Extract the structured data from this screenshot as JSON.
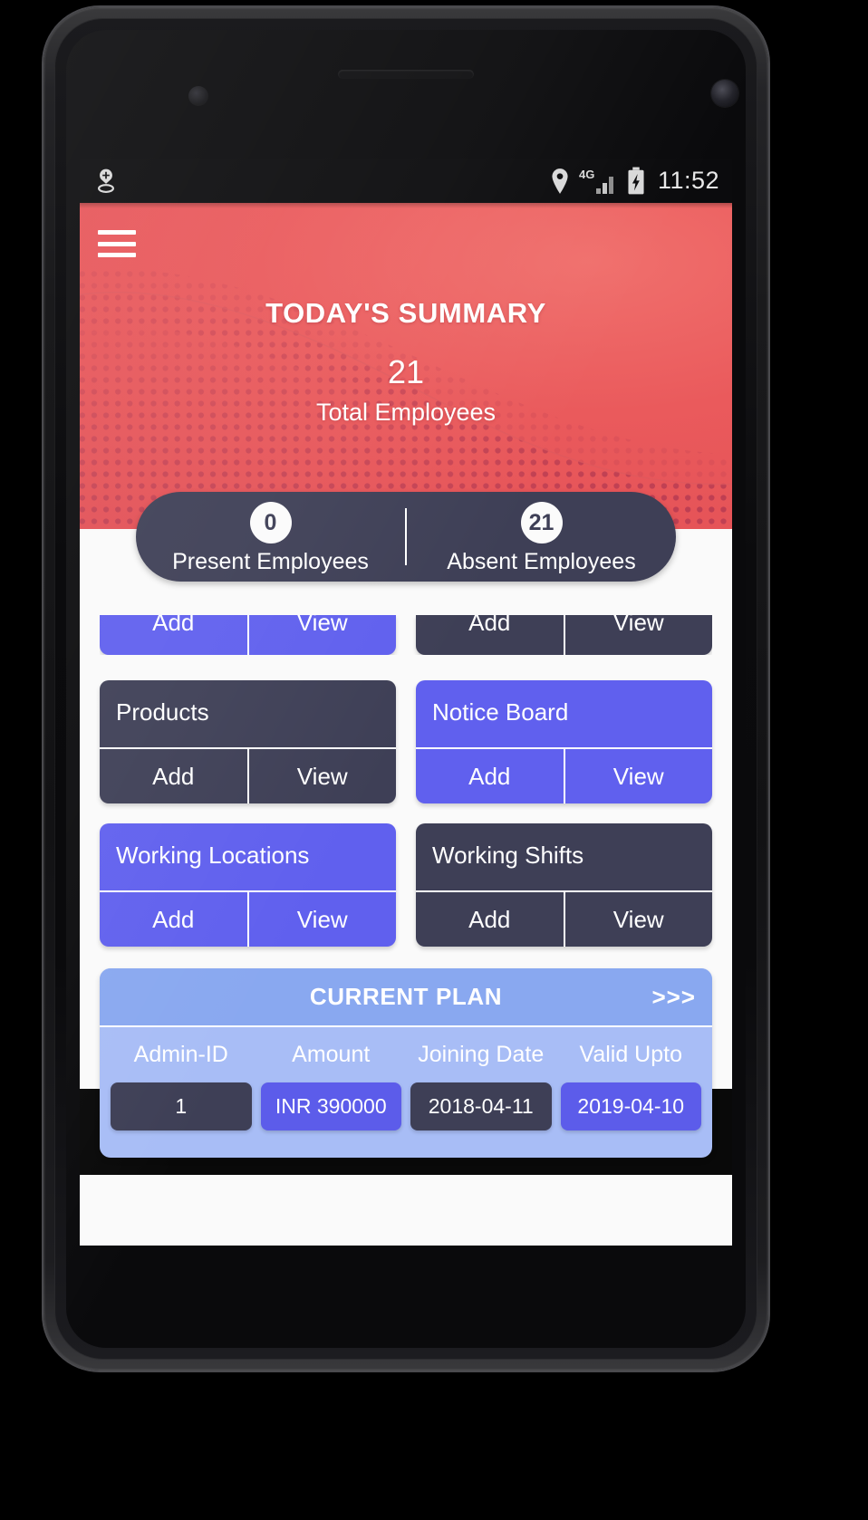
{
  "status_bar": {
    "time": "11:52",
    "left_icons": [
      "location-sharing-icon"
    ],
    "right_icons": [
      "location-pin-icon",
      "network-4g-icon",
      "signal-bars-icon",
      "battery-charging-icon"
    ],
    "network_label": "4G"
  },
  "header": {
    "menu_icon": "hamburger-menu-icon",
    "title": "TODAY'S SUMMARY",
    "total_count": "21",
    "total_label": "Total Employees",
    "accent_color": "#ea5a5c"
  },
  "summary": {
    "present": {
      "count": "0",
      "label": "Present Employees"
    },
    "absent": {
      "count": "21",
      "label": "Absent Employees"
    },
    "pill_color": "#3e3f56"
  },
  "cards": {
    "clipped_top": [
      {
        "add_label": "Add",
        "view_label": "View",
        "theme": "purple"
      },
      {
        "add_label": "Add",
        "view_label": "View",
        "theme": "dark"
      }
    ],
    "rows": [
      [
        {
          "title": "Products",
          "add_label": "Add",
          "view_label": "View",
          "theme": "dark"
        },
        {
          "title": "Notice Board",
          "add_label": "Add",
          "view_label": "View",
          "theme": "purple"
        }
      ],
      [
        {
          "title": "Working Locations",
          "add_label": "Add",
          "view_label": "View",
          "theme": "purple"
        },
        {
          "title": "Working Shifts",
          "add_label": "Add",
          "view_label": "View",
          "theme": "dark"
        }
      ]
    ],
    "purple_color": "#6060ee",
    "dark_color": "#3e3f56"
  },
  "current_plan": {
    "title": "CURRENT PLAN",
    "more_label": ">>>",
    "columns": [
      "Admin-ID",
      "Amount",
      "Joining Date",
      "Valid Upto"
    ],
    "values": [
      {
        "text": "1",
        "theme": "dark"
      },
      {
        "text": "INR 390000",
        "theme": "purple"
      },
      {
        "text": "2018-04-11",
        "theme": "dark"
      },
      {
        "text": "2019-04-10",
        "theme": "purple"
      }
    ],
    "header_color": "#89a8f0",
    "body_color": "#a8bdf6"
  },
  "nav_bar": {
    "back_label": "back-button",
    "home_label": "home-button",
    "recents_label": "recents-button"
  }
}
